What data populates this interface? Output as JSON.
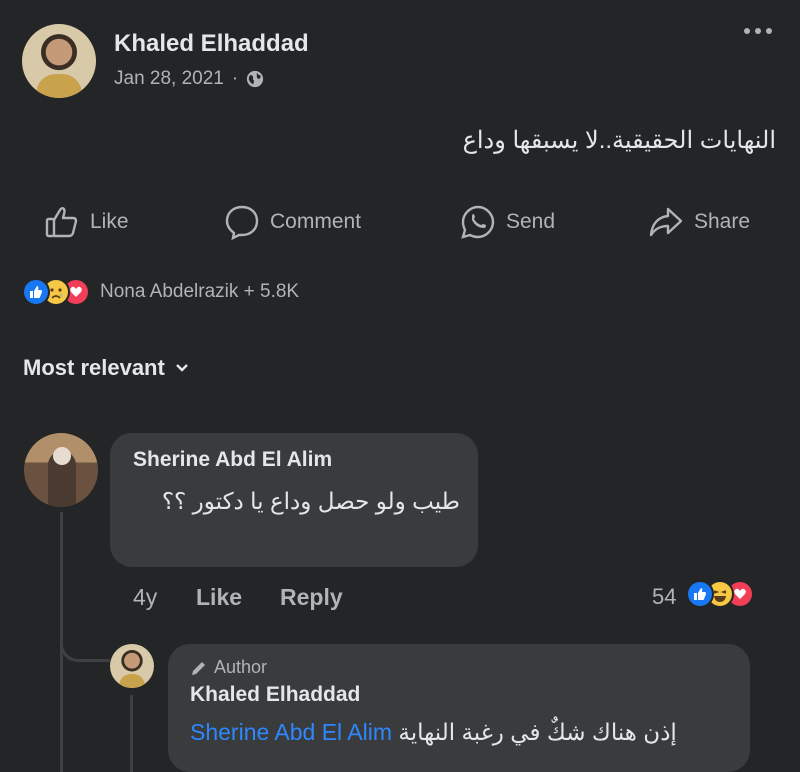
{
  "post": {
    "author": "Khaled Elhaddad",
    "date": "Jan 28, 2021",
    "date_separator": "·",
    "text": "النهايات الحقيقية..لا يسبقها وداع",
    "icons": {
      "privacy": "globe-icon",
      "more": "more-options-icon"
    }
  },
  "actions": {
    "like": "Like",
    "comment": "Comment",
    "send": "Send",
    "share": "Share"
  },
  "reactions": {
    "summary": "Nona Abdelrazik + 5.8K",
    "types": [
      "like",
      "sad",
      "love"
    ]
  },
  "sort": {
    "label": "Most relevant"
  },
  "comment": {
    "author": "Sherine Abd El Alim",
    "text": "طيب ولو حصل وداع يا دكتور ؟؟",
    "age": "4y",
    "like": "Like",
    "reply": "Reply",
    "reaction_count": "54",
    "reaction_types": [
      "like",
      "haha",
      "love"
    ]
  },
  "reply": {
    "badge": "Author",
    "author": "Khaled Elhaddad",
    "mention": "Sherine Abd El Alim",
    "text": "إذن هناك شكٌ في رغبة النهاية"
  },
  "colors": {
    "background": "#242526",
    "bubble": "#3a3b3c",
    "text": "#e4e6eb",
    "secondary": "#b0b3b8",
    "link": "#2d88ff",
    "like_blue": "#1877f2",
    "love_red": "#f33e58"
  }
}
